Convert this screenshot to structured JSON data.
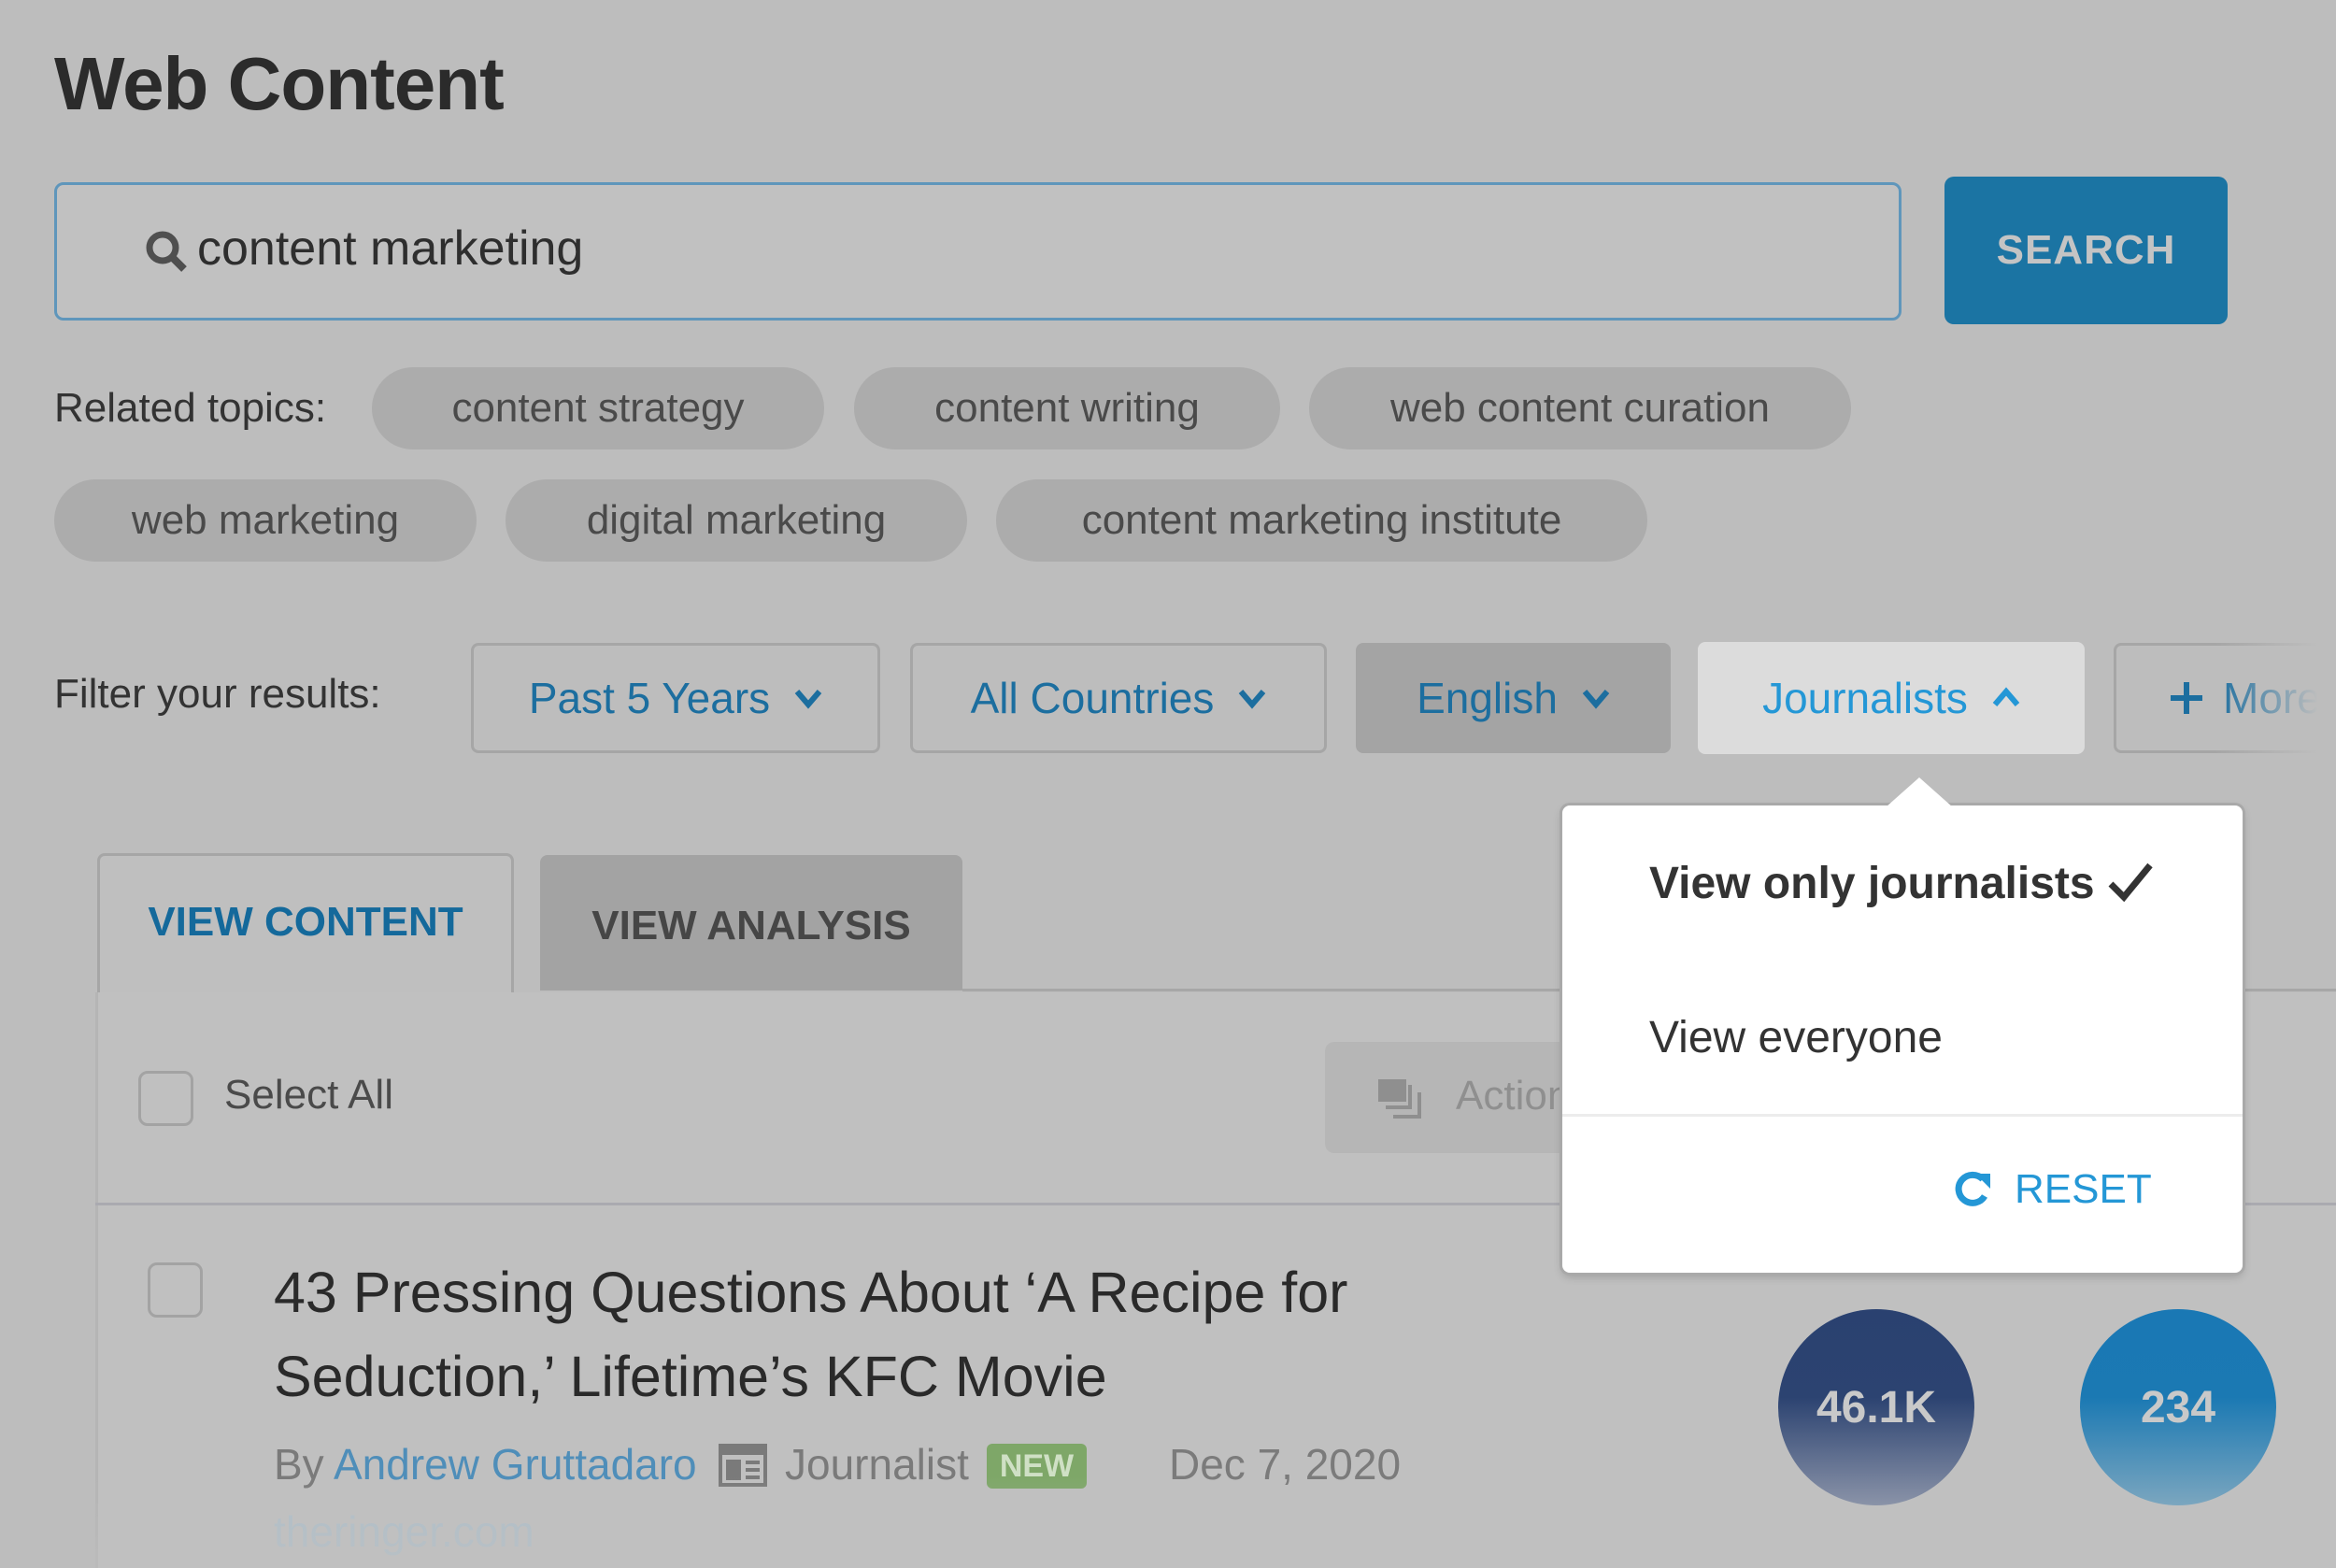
{
  "page": {
    "title": "Web Content"
  },
  "search": {
    "value": "content marketing",
    "button_label": "SEARCH",
    "icon": "search-icon"
  },
  "related": {
    "label": "Related topics:",
    "topics": [
      "content strategy",
      "content writing",
      "web content curation",
      "web marketing",
      "digital marketing",
      "content marketing institute"
    ]
  },
  "filters": {
    "label": "Filter your results:",
    "items": [
      {
        "label": "Past 5 Years",
        "icon": "chevron-down-icon"
      },
      {
        "label": "All Countries",
        "icon": "chevron-down-icon"
      },
      {
        "label": "English",
        "icon": "chevron-down-icon"
      },
      {
        "label": "Journalists",
        "icon": "chevron-up-icon"
      },
      {
        "label": "More",
        "icon": "plus-icon"
      }
    ]
  },
  "dropdown": {
    "options": [
      {
        "label": "View only journalists",
        "selected": true
      },
      {
        "label": "View everyone",
        "selected": false
      }
    ],
    "reset_label": "RESET"
  },
  "tabs": [
    {
      "label": "VIEW CONTENT",
      "active": true
    },
    {
      "label": "VIEW ANALYSIS",
      "active": false
    }
  ],
  "toolbar": {
    "select_all_label": "Select All",
    "actions_label": "Actions"
  },
  "articles": [
    {
      "title": "43 Pressing Questions About ‘A Recipe for Seduction,’ Lifetime’s KFC Movie",
      "by_label": "By",
      "author": "Andrew Gruttadaro",
      "author_type": "Journalist",
      "badge": "NEW",
      "date": "Dec 7, 2020",
      "domain": "theringer.com",
      "metric_1": "46.1K",
      "metric_2": "234"
    }
  ],
  "colors": {
    "accent": "#1b74a3",
    "accent_light": "#2497d6",
    "badge_new": "#7ea768",
    "metric_1": "#2a4170",
    "metric_2": "#1a78b4"
  }
}
